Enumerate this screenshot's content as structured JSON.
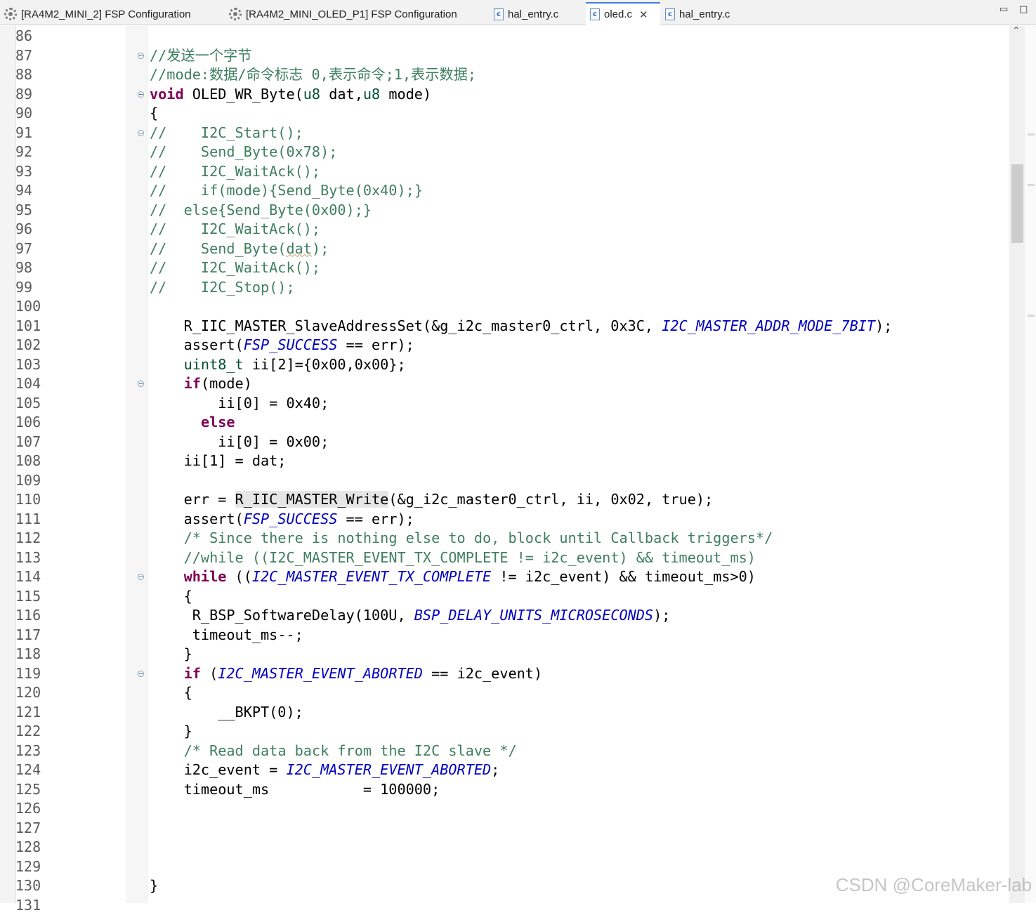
{
  "tabs": [
    {
      "label": "[RA4M2_MINI_2] FSP Configuration",
      "icon": "gear-icon",
      "active": false
    },
    {
      "label": "[RA4M2_MINI_OLED_P1] FSP Configuration",
      "icon": "gear-icon",
      "active": false
    },
    {
      "label": "hal_entry.c",
      "icon": "c-file-icon",
      "active": false
    },
    {
      "label": "oled.c",
      "icon": "c-file-icon",
      "active": true
    },
    {
      "label": "hal_entry.c",
      "icon": "c-file-icon",
      "active": false
    }
  ],
  "window_controls": {
    "minimize": "▭",
    "maximize": "□"
  },
  "file_icon_letter": "c",
  "close_symbol": "✕",
  "scroll_up_symbol": "⌃",
  "watermark": "CSDN @CoreMaker-lab",
  "editor": {
    "lines": [
      {
        "n": "86"
      },
      {
        "n": "87",
        "fold": true,
        "html": "<span class='cm'>//发送一个字节</span>"
      },
      {
        "n": "88",
        "html": "<span class='cm'>//mode:数据/命令标志 0,表示命令;1,表示数据;</span>"
      },
      {
        "n": "89",
        "fold": true,
        "html": "<span class='kw'>void</span> OLED_WR_Byte(<span class='ty'>u8</span> dat,<span class='ty'>u8</span> mode)"
      },
      {
        "n": "90",
        "html": "{"
      },
      {
        "n": "91",
        "fold": true,
        "html": "<span class='cm'>//    I2C_Start();</span>"
      },
      {
        "n": "92",
        "html": "<span class='cm'>//    Send_Byte(0x78);</span>"
      },
      {
        "n": "93",
        "html": "<span class='cm'>//    I2C_WaitAck();</span>"
      },
      {
        "n": "94",
        "html": "<span class='cm'>//    if(mode){Send_Byte(0x40);}</span>"
      },
      {
        "n": "95",
        "html": "<span class='cm'>//  else{Send_Byte(0x00);}</span>"
      },
      {
        "n": "96",
        "html": "<span class='cm'>//    I2C_WaitAck();</span>"
      },
      {
        "n": "97",
        "html": "<span class='cm'>//    Send_Byte(<span class='squig'>dat</span>);</span>"
      },
      {
        "n": "98",
        "html": "<span class='cm'>//    I2C_WaitAck();</span>"
      },
      {
        "n": "99",
        "html": "<span class='cm'>//    I2C_Stop();</span>"
      },
      {
        "n": "100"
      },
      {
        "n": "101",
        "html": "    R_IIC_MASTER_SlaveAddressSet(&amp;g_i2c_master0_ctrl, 0x3C, <span class='mac'>I2C_MASTER_ADDR_MODE_7BIT</span>);"
      },
      {
        "n": "102",
        "html": "    assert(<span class='mac'>FSP_SUCCESS</span> == err);"
      },
      {
        "n": "103",
        "html": "    <span class='ty'>uint8_t</span> ii[2]={0x00,0x00};"
      },
      {
        "n": "104",
        "fold": true,
        "html": "    <span class='kw'>if</span>(mode)"
      },
      {
        "n": "105",
        "html": "        ii[0] = 0x40;"
      },
      {
        "n": "106",
        "html": "      <span class='kw'>else</span>"
      },
      {
        "n": "107",
        "html": "        ii[0] = 0x00;"
      },
      {
        "n": "108",
        "html": "    ii[1] = dat;"
      },
      {
        "n": "109"
      },
      {
        "n": "110",
        "html": "    err = <span class='hl'>R_IIC_MASTER_Write</span>(&amp;g_i2c_master0_ctrl, ii, 0x02, true);"
      },
      {
        "n": "111",
        "html": "    assert(<span class='mac'>FSP_SUCCESS</span> == err);"
      },
      {
        "n": "112",
        "html": "    <span class='cm'>/* Since there is nothing else to do, block until Callback triggers*/</span>"
      },
      {
        "n": "113",
        "html": "    <span class='cm'>//while ((I2C_MASTER_EVENT_TX_COMPLETE != i2c_event) &amp;&amp; timeout_ms)</span>"
      },
      {
        "n": "114",
        "fold": true,
        "html": "    <span class='kw'>while</span> ((<span class='mac'>I2C_MASTER_EVENT_TX_COMPLETE</span> != i2c_event) &amp;&amp; timeout_ms&gt;0)"
      },
      {
        "n": "115",
        "html": "    {"
      },
      {
        "n": "116",
        "html": "     R_BSP_SoftwareDelay(100U, <span class='mac'>BSP_DELAY_UNITS_MICROSECONDS</span>);"
      },
      {
        "n": "117",
        "html": "     timeout_ms--;"
      },
      {
        "n": "118",
        "html": "    }"
      },
      {
        "n": "119",
        "fold": true,
        "html": "    <span class='kw'>if</span> (<span class='mac'>I2C_MASTER_EVENT_ABORTED</span> == i2c_event)"
      },
      {
        "n": "120",
        "html": "    {"
      },
      {
        "n": "121",
        "html": "        __BKPT(0);"
      },
      {
        "n": "122",
        "html": "    }"
      },
      {
        "n": "123",
        "html": "    <span class='cm'>/* Read data back from the I2C slave */</span>"
      },
      {
        "n": "124",
        "html": "    i2c_event = <span class='mac'>I2C_MASTER_EVENT_ABORTED</span>;"
      },
      {
        "n": "125",
        "html": "    timeout_ms           = 100000;"
      },
      {
        "n": "126"
      },
      {
        "n": "127"
      },
      {
        "n": "128"
      },
      {
        "n": "129"
      },
      {
        "n": "130",
        "html": "}"
      },
      {
        "n": "131"
      }
    ]
  }
}
